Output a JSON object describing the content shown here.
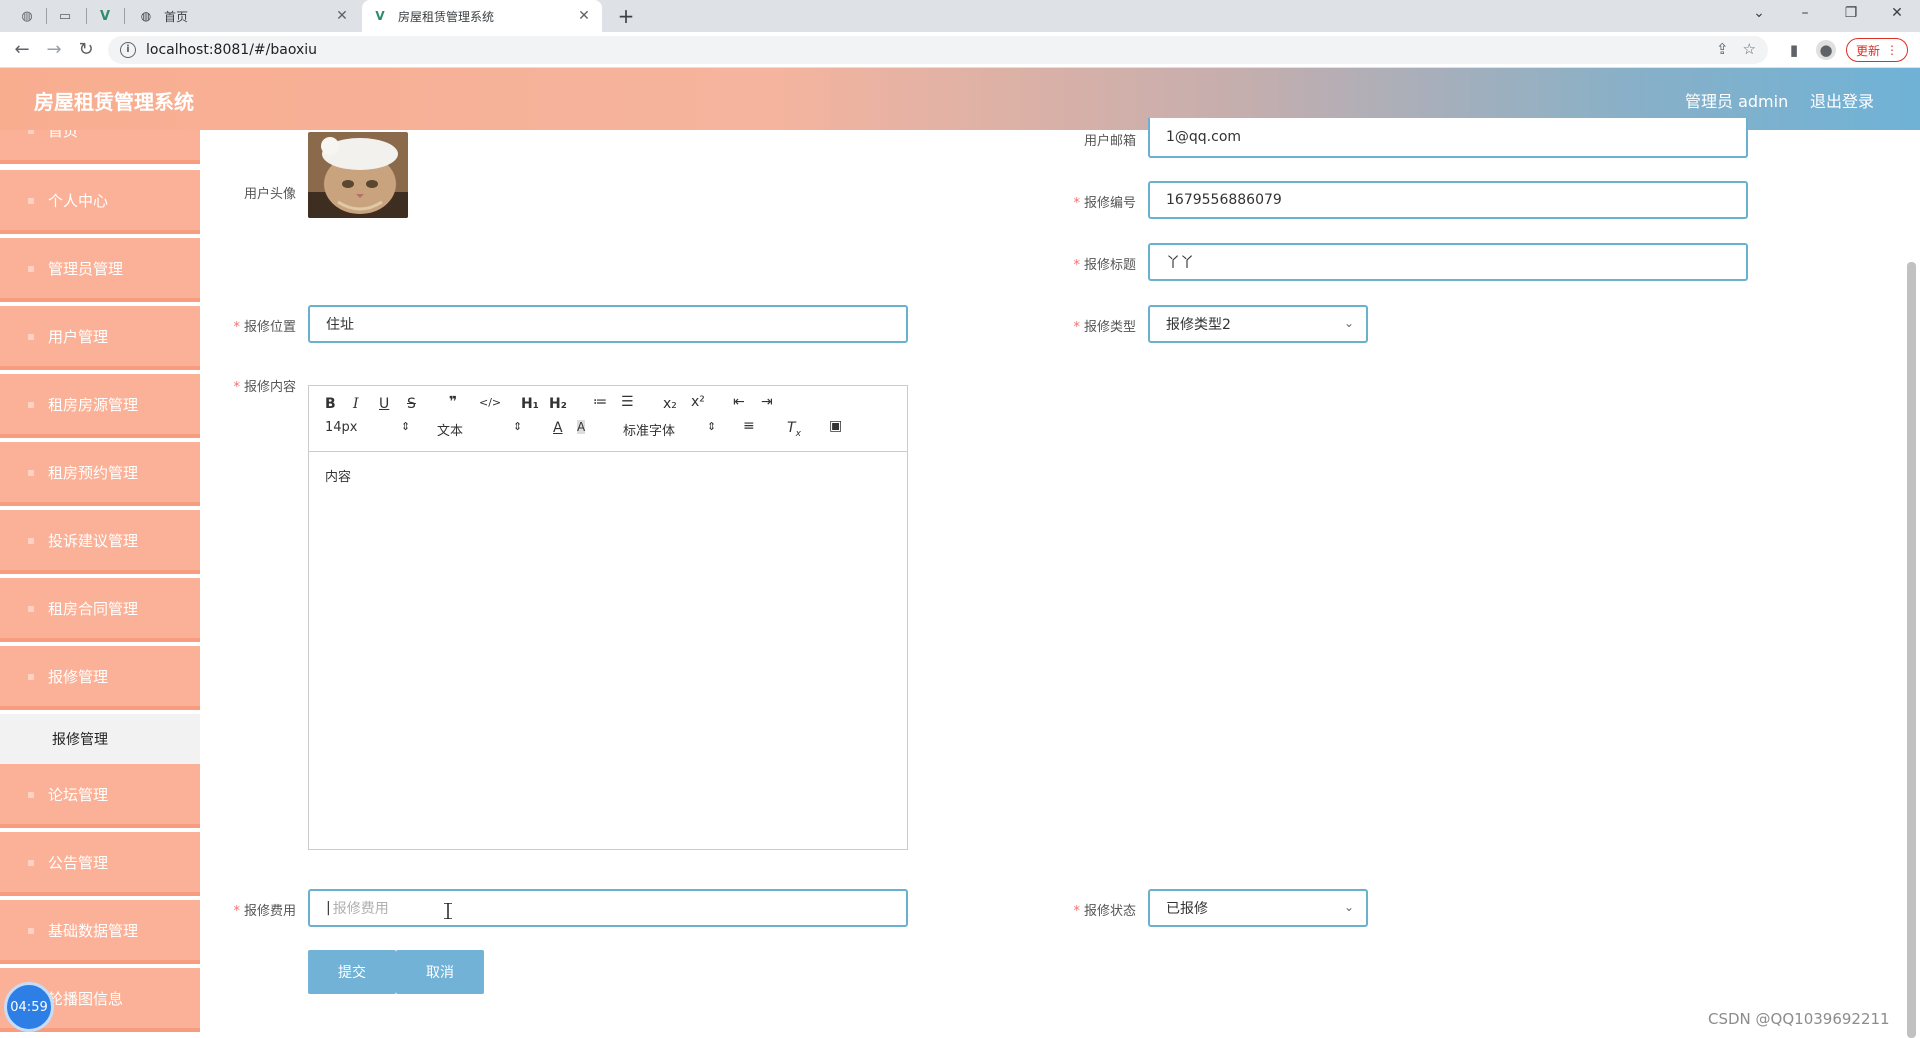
{
  "browser": {
    "tabs": [
      {
        "title": "首页",
        "active": false
      },
      {
        "title": "房屋租赁管理系统",
        "active": true
      }
    ],
    "url": "localhost:8081/#/baoxiu",
    "update_label": "更新",
    "icons": [
      "back-icon",
      "forward-icon",
      "reload-icon",
      "info-icon",
      "share-icon",
      "star-icon",
      "sidepanel-icon",
      "profile-icon",
      "menu-icon"
    ]
  },
  "header": {
    "title": "房屋租赁管理系统",
    "admin_label": "管理员 admin",
    "logout_label": "退出登录",
    "gradient": [
      "#f9ad8f",
      "#6fb2d6"
    ]
  },
  "sidebar": {
    "items": [
      {
        "label": "首页"
      },
      {
        "label": "个人中心"
      },
      {
        "label": "管理员管理"
      },
      {
        "label": "用户管理"
      },
      {
        "label": "租房房源管理"
      },
      {
        "label": "租房预约管理"
      },
      {
        "label": "投诉建议管理"
      },
      {
        "label": "租房合同管理"
      },
      {
        "label": "报修管理"
      },
      {
        "label": "论坛管理"
      },
      {
        "label": "公告管理"
      },
      {
        "label": "基础数据管理"
      },
      {
        "label": "轮播图信息"
      }
    ],
    "sub_item": {
      "label": "报修管理"
    },
    "item_color": "#fbb197"
  },
  "form": {
    "avatar_label": "用户头像",
    "email": {
      "label": "用户邮箱",
      "value": "1@qq.com"
    },
    "repair_no": {
      "label": "报修编号",
      "value": "1679556886079"
    },
    "repair_title": {
      "label": "报修标题",
      "value": "丫丫"
    },
    "location": {
      "label": "报修位置",
      "value": "住址"
    },
    "repair_type": {
      "label": "报修类型",
      "value": "报修类型2"
    },
    "content": {
      "label": "报修内容",
      "value": "内容"
    },
    "cost": {
      "label": "报修费用",
      "placeholder": "报修费用"
    },
    "status": {
      "label": "报修状态",
      "value": "已报修"
    },
    "submit_label": "提交",
    "cancel_label": "取消",
    "accent": "#6ab0cf"
  },
  "editor": {
    "font_size": "14px",
    "block_type": "文本",
    "font_family": "标准字体",
    "buttons_row1": [
      "B",
      "I",
      "U",
      "S",
      "❞",
      "</>",
      "H₁",
      "H₂",
      "≔",
      "☰",
      "x₂",
      "x²",
      "⇤",
      "⇥"
    ],
    "buttons_row2": [
      "A",
      "A̲",
      "≡",
      "Tx",
      "🖼"
    ]
  },
  "overlay": {
    "timer": "04:59",
    "watermark": "CSDN @QQ1039692211"
  }
}
